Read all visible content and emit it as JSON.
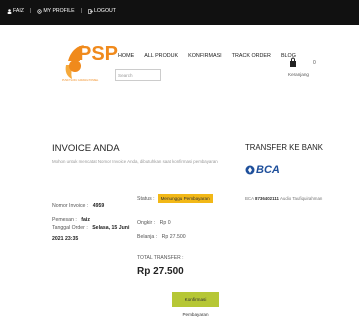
{
  "topbar": {
    "items": [
      {
        "icon": "user-icon",
        "label": "FAIZ"
      },
      {
        "icon": "gear-icon",
        "label": "MY PROFILE"
      },
      {
        "icon": "logout-icon",
        "label": "LOGOUT"
      }
    ],
    "separator": "|"
  },
  "header": {
    "logo_text": "PSP",
    "logo_tagline": "PUSAT SUKU CADANG PONSEL",
    "nav": [
      "HOME",
      "ALL PRODUK",
      "KONFIRMASI",
      "TRACK ORDER",
      "BLOG"
    ],
    "search_placeholder": "Search",
    "cart_label": "Keranjang",
    "cart_count": "0"
  },
  "invoice": {
    "title": "INVOICE ANDA",
    "subtitle": "Mohon untuk mencatat Nomor Invoice Anda, dibutuhkan saat konfirmasi pembayaran",
    "nomor_label": "Nomor Invoice :",
    "nomor_value": "4959",
    "pemesan_label": "Pemesan :",
    "pemesan_value": "faiz",
    "tanggal_label": "Tanggal Order :",
    "tanggal_value": "Selasa, 15 Juni 2021 23:35",
    "status_label": "Status :",
    "status_value": "Menunggu Pembayaran",
    "ongkir_label": "Ongkir :",
    "ongkir_value": "Rp 0",
    "belanja_label": "Belanja :",
    "belanja_value": "Rp 27.500",
    "total_label": "TOTAL TRANSFER :",
    "total_value": "Rp 27.500",
    "confirm_button": "Konfirmasi Pembayaran"
  },
  "bank": {
    "title": "TRANSFER KE BANK",
    "name": "BCA",
    "detail_prefix": "BCA",
    "account": "8736402111",
    "holder": "Audio Taufiquirahman"
  },
  "colors": {
    "topbar": "#111111",
    "status_badge": "#f2b817",
    "confirm_button": "#b6c735",
    "logo_orange": "#f08a1c",
    "bca_blue": "#1e4f9b"
  }
}
